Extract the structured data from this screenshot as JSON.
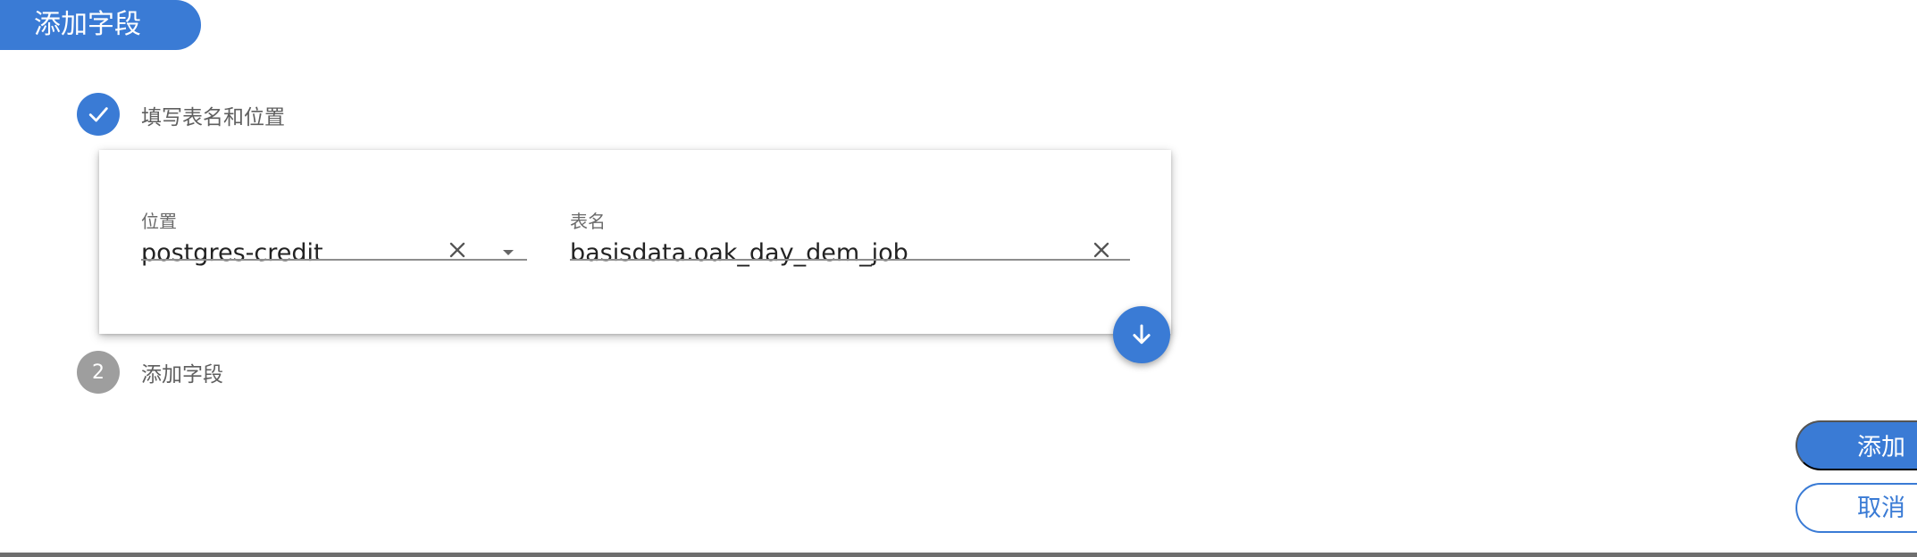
{
  "header": {
    "title": "添加字段"
  },
  "steps": [
    {
      "label": "填写表名和位置",
      "status": "completed",
      "icon": "check-icon"
    },
    {
      "number": "2",
      "label": "添加字段",
      "status": "pending"
    }
  ],
  "form": {
    "location": {
      "label": "位置",
      "value": "postgres-credit",
      "icons": [
        "clear-icon",
        "dropdown-arrow-icon"
      ]
    },
    "table": {
      "label": "表名",
      "value": "basisdata.oak_day_dem_job",
      "icons": [
        "clear-icon"
      ]
    }
  },
  "fab": {
    "icon": "arrow-down-icon"
  },
  "actions": {
    "add_label": "添加",
    "cancel_label": "取消"
  },
  "colors": {
    "primary": "#3a7bd5",
    "pending_step": "#9e9e9e"
  }
}
